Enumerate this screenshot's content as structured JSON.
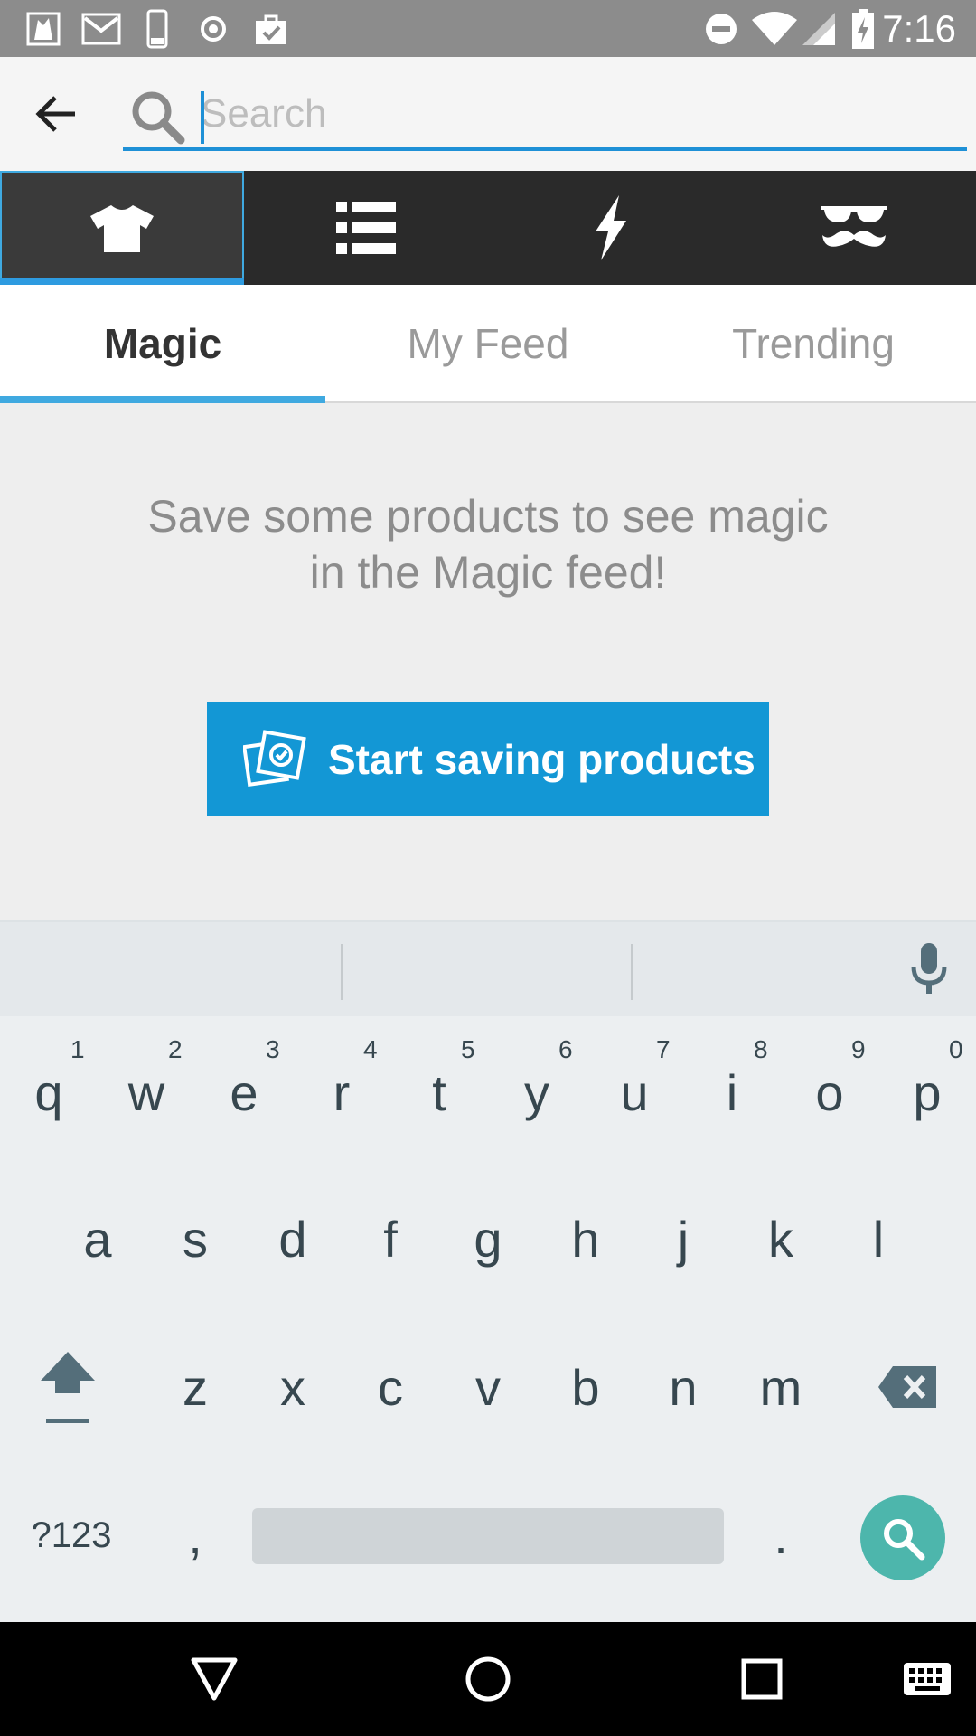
{
  "status_bar": {
    "time": "7:16",
    "left_icons": [
      "photo-icon",
      "gmail-icon",
      "phone-icon",
      "record-icon",
      "clipboard-check-icon"
    ],
    "right_icons": [
      "do-not-disturb-icon",
      "wifi-icon",
      "signal-icon",
      "battery-charging-icon"
    ]
  },
  "header": {
    "search_placeholder": "Search",
    "search_value": ""
  },
  "category_tabs": [
    {
      "icon": "tshirt-icon",
      "active": true
    },
    {
      "icon": "list-icon",
      "active": false
    },
    {
      "icon": "lightning-icon",
      "active": false
    },
    {
      "icon": "mustache-glasses-icon",
      "active": false
    }
  ],
  "feed_tabs": [
    {
      "label": "Magic",
      "active": true
    },
    {
      "label": "My Feed",
      "active": false
    },
    {
      "label": "Trending",
      "active": false
    }
  ],
  "empty_state": {
    "message_line1": "Save some products to see magic",
    "message_line2": "in the Magic feed!",
    "button_label": "Start saving products"
  },
  "keyboard": {
    "row1": [
      "q",
      "w",
      "e",
      "r",
      "t",
      "y",
      "u",
      "i",
      "o",
      "p"
    ],
    "row1_hints": [
      "1",
      "2",
      "3",
      "4",
      "5",
      "6",
      "7",
      "8",
      "9",
      "0"
    ],
    "row2": [
      "a",
      "s",
      "d",
      "f",
      "g",
      "h",
      "j",
      "k",
      "l"
    ],
    "row3": [
      "z",
      "x",
      "c",
      "v",
      "b",
      "n",
      "m"
    ],
    "symbols_label": "?123",
    "comma": ",",
    "period": "."
  },
  "colors": {
    "accent": "#1397d5",
    "tab_indicator": "#3fa9e0",
    "keyboard_action": "#4db6ac"
  }
}
